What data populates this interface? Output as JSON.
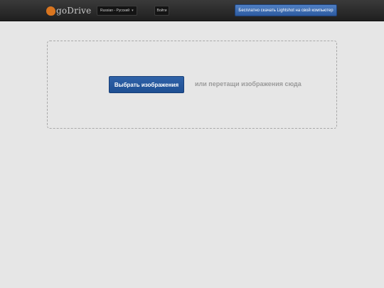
{
  "header": {
    "logo_text": "goDrive",
    "language_selected": "Russian - Русский",
    "language_chevron": "▾",
    "login_label": "Войти",
    "download_label": "Бесплатно скачать Lightshot на свой компьютер"
  },
  "upload": {
    "choose_label": "Выбрать изображения",
    "drag_hint": "или перетащи изображения сюда"
  },
  "colors": {
    "accent": "#2c5aa0",
    "logo": "#d9751f",
    "background": "#e6e6e6",
    "topbar": "#2a2a2a"
  },
  "icons": {
    "logo": "cloud-logo-icon",
    "dropdown": "chevron-down-icon"
  }
}
